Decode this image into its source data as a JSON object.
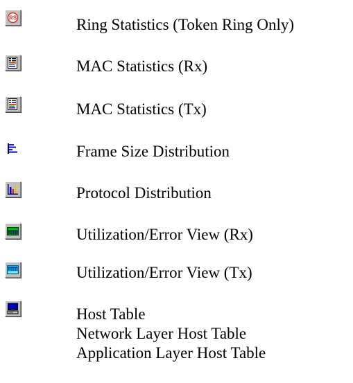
{
  "legend": {
    "items": [
      {
        "icon": "rs-icon",
        "label": "Ring Statistics (Token Ring Only)"
      },
      {
        "icon": "mac-statistics-icon",
        "label": "MAC Statistics (Rx)"
      },
      {
        "icon": "mac-statistics-icon",
        "label": "MAC Statistics (Tx)"
      },
      {
        "icon": "frame-size-icon",
        "label": "Frame Size Distribution"
      },
      {
        "icon": "protocol-distribution-icon",
        "label": "Protocol Distribution"
      },
      {
        "icon": "utilization-rx-icon",
        "label": "Utilization/Error View (Rx)"
      },
      {
        "icon": "utilization-tx-icon",
        "label": "Utilization/Error View (Tx)"
      },
      {
        "icon": "host-table-icon",
        "label": "Host Table",
        "sublabels": [
          "Network Layer Host Table",
          "Application Layer Host Table"
        ]
      }
    ]
  }
}
